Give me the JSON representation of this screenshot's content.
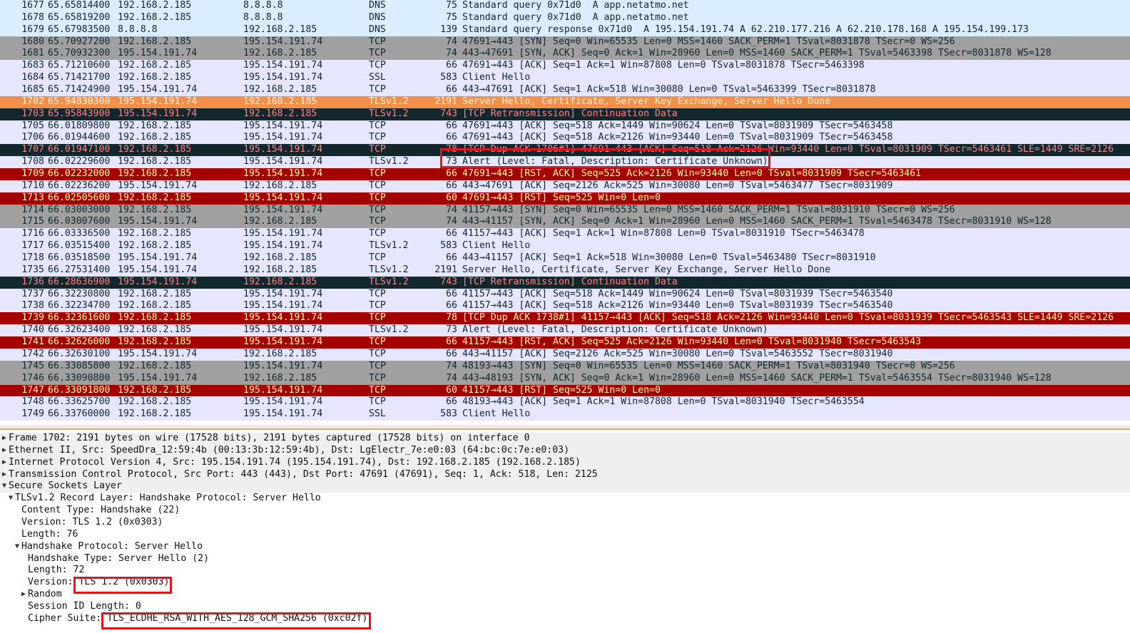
{
  "packet_list": {
    "rows": [
      {
        "no": "1677",
        "time": "65.65814400",
        "src": "192.168.2.185",
        "dst": "8.8.8.8",
        "proto": "DNS",
        "len": "75",
        "info": "Standard query 0x71d0  A app.netatmo.net",
        "style": "dns"
      },
      {
        "no": "1678",
        "time": "65.65819200",
        "src": "192.168.2.185",
        "dst": "8.8.8.8",
        "proto": "DNS",
        "len": "75",
        "info": "Standard query 0x71d0  A app.netatmo.net",
        "style": "dns"
      },
      {
        "no": "1679",
        "time": "65.67983500",
        "src": "8.8.8.8",
        "dst": "192.168.2.185",
        "proto": "DNS",
        "len": "139",
        "info": "Standard query response 0x71d0  A 195.154.191.74 A 62.210.177.216 A 62.210.178.168 A 195.154.199.173",
        "style": "dns"
      },
      {
        "no": "1680",
        "time": "65.70927200",
        "src": "192.168.2.185",
        "dst": "195.154.191.74",
        "proto": "TCP",
        "len": "74",
        "info": "47691→443 [SYN] Seq=0 Win=65535 Len=0 MSS=1460 SACK_PERM=1 TSval=8031878 TSecr=0 WS=256",
        "style": "gray"
      },
      {
        "no": "1681",
        "time": "65.70932300",
        "src": "195.154.191.74",
        "dst": "192.168.2.185",
        "proto": "TCP",
        "len": "74",
        "info": "443→47691 [SYN, ACK] Seq=0 Ack=1 Win=28960 Len=0 MSS=1460 SACK_PERM=1 TSval=5463398 TSecr=8031878 WS=128",
        "style": "gray"
      },
      {
        "no": "1683",
        "time": "65.71210600",
        "src": "192.168.2.185",
        "dst": "195.154.191.74",
        "proto": "TCP",
        "len": "66",
        "info": "47691→443 [ACK] Seq=1 Ack=1 Win=87808 Len=0 TSval=8031878 TSecr=5463398",
        "style": "tcp"
      },
      {
        "no": "1684",
        "time": "65.71421700",
        "src": "192.168.2.185",
        "dst": "195.154.191.74",
        "proto": "SSL",
        "len": "583",
        "info": "Client Hello",
        "style": "tcp"
      },
      {
        "no": "1685",
        "time": "65.71424900",
        "src": "195.154.191.74",
        "dst": "192.168.2.185",
        "proto": "TCP",
        "len": "66",
        "info": "443→47691 [ACK] Seq=1 Ack=518 Win=30080 Len=0 TSval=5463399 TSecr=8031878",
        "style": "tcp"
      },
      {
        "no": "1702",
        "time": "65.94830300",
        "src": "195.154.191.74",
        "dst": "192.168.2.185",
        "proto": "TLSv1.2",
        "len": "2191",
        "info": "Server Hello, Certificate, Server Key Exchange, Server Hello Done",
        "style": "orange"
      },
      {
        "no": "1703",
        "time": "65.95843900",
        "src": "195.154.191.74",
        "dst": "192.168.2.185",
        "proto": "TLSv1.2",
        "len": "743",
        "info": "[TCP Retransmission] Continuation Data",
        "style": "dark"
      },
      {
        "no": "1705",
        "time": "66.01809800",
        "src": "192.168.2.185",
        "dst": "195.154.191.74",
        "proto": "TCP",
        "len": "66",
        "info": "47691→443 [ACK] Seq=518 Ack=1449 Win=90624 Len=0 TSval=8031909 TSecr=5463458",
        "style": "tcp"
      },
      {
        "no": "1706",
        "time": "66.01944600",
        "src": "192.168.2.185",
        "dst": "195.154.191.74",
        "proto": "TCP",
        "len": "66",
        "info": "47691→443 [ACK] Seq=518 Ack=2126 Win=93440 Len=0 TSval=8031909 TSecr=5463458",
        "style": "tcp"
      },
      {
        "no": "1707",
        "time": "66.01947100",
        "src": "192.168.2.185",
        "dst": "195.154.191.74",
        "proto": "TCP",
        "len": "78",
        "info": "[TCP Dup ACK 1706#1] 47691→443 [ACK] Seq=518 Ack=2126 Win=93440 Len=0 TSval=8031909 TSecr=5463461 SLE=1449 SRE=2126",
        "style": "dark"
      },
      {
        "no": "1708",
        "time": "66.02229600",
        "src": "192.168.2.185",
        "dst": "195.154.191.74",
        "proto": "TLSv1.2",
        "len": "73",
        "info": "Alert (Level: Fatal, Description: Certificate Unknown)",
        "style": "tcp"
      },
      {
        "no": "1709",
        "time": "66.02232000",
        "src": "192.168.2.185",
        "dst": "195.154.191.74",
        "proto": "TCP",
        "len": "66",
        "info": "47691→443 [RST, ACK] Seq=525 Ack=2126 Win=93440 Len=0 TSval=8031909 TSecr=5463461",
        "style": "red"
      },
      {
        "no": "1710",
        "time": "66.02236200",
        "src": "195.154.191.74",
        "dst": "192.168.2.185",
        "proto": "TCP",
        "len": "66",
        "info": "443→47691 [ACK] Seq=2126 Ack=525 Win=30080 Len=0 TSval=5463477 TSecr=8031909",
        "style": "tcp"
      },
      {
        "no": "1713",
        "time": "66.02505600",
        "src": "192.168.2.185",
        "dst": "195.154.191.74",
        "proto": "TCP",
        "len": "60",
        "info": "47691→443 [RST] Seq=525 Win=0 Len=0",
        "style": "red"
      },
      {
        "no": "1714",
        "time": "66.03003000",
        "src": "192.168.2.185",
        "dst": "195.154.191.74",
        "proto": "TCP",
        "len": "74",
        "info": "41157→443 [SYN] Seq=0 Win=65535 Len=0 MSS=1460 SACK_PERM=1 TSval=8031910 TSecr=0 WS=256",
        "style": "gray"
      },
      {
        "no": "1715",
        "time": "66.03007600",
        "src": "195.154.191.74",
        "dst": "192.168.2.185",
        "proto": "TCP",
        "len": "74",
        "info": "443→41157 [SYN, ACK] Seq=0 Ack=1 Win=28960 Len=0 MSS=1460 SACK_PERM=1 TSval=5463478 TSecr=8031910 WS=128",
        "style": "gray"
      },
      {
        "no": "1716",
        "time": "66.03336500",
        "src": "192.168.2.185",
        "dst": "195.154.191.74",
        "proto": "TCP",
        "len": "66",
        "info": "41157→443 [ACK] Seq=1 Ack=1 Win=87808 Len=0 TSval=8031910 TSecr=5463478",
        "style": "tcp"
      },
      {
        "no": "1717",
        "time": "66.03515400",
        "src": "192.168.2.185",
        "dst": "195.154.191.74",
        "proto": "TLSv1.2",
        "len": "583",
        "info": "Client Hello",
        "style": "tcp"
      },
      {
        "no": "1718",
        "time": "66.03518500",
        "src": "195.154.191.74",
        "dst": "192.168.2.185",
        "proto": "TCP",
        "len": "66",
        "info": "443→41157 [ACK] Seq=1 Ack=518 Win=30080 Len=0 TSval=5463480 TSecr=8031910",
        "style": "tcp"
      },
      {
        "no": "1735",
        "time": "66.27531400",
        "src": "195.154.191.74",
        "dst": "192.168.2.185",
        "proto": "TLSv1.2",
        "len": "2191",
        "info": "Server Hello, Certificate, Server Key Exchange, Server Hello Done",
        "style": "tcp"
      },
      {
        "no": "1736",
        "time": "66.28636900",
        "src": "195.154.191.74",
        "dst": "192.168.2.185",
        "proto": "TLSv1.2",
        "len": "743",
        "info": "[TCP Retransmission] Continuation Data",
        "style": "dark"
      },
      {
        "no": "1737",
        "time": "66.32230800",
        "src": "192.168.2.185",
        "dst": "195.154.191.74",
        "proto": "TCP",
        "len": "66",
        "info": "41157→443 [ACK] Seq=518 Ack=1449 Win=90624 Len=0 TSval=8031939 TSecr=5463540",
        "style": "tcp"
      },
      {
        "no": "1738",
        "time": "66.32234700",
        "src": "192.168.2.185",
        "dst": "195.154.191.74",
        "proto": "TCP",
        "len": "66",
        "info": "41157→443 [ACK] Seq=518 Ack=2126 Win=93440 Len=0 TSval=8031939 TSecr=5463540",
        "style": "tcp"
      },
      {
        "no": "1739",
        "time": "66.32361600",
        "src": "192.168.2.185",
        "dst": "195.154.191.74",
        "proto": "TCP",
        "len": "78",
        "info": "[TCP Dup ACK 1738#1] 41157→443 [ACK] Seq=518 Ack=2126 Win=93440 Len=0 TSval=8031939 TSecr=5463543 SLE=1449 SRE=2126",
        "style": "red"
      },
      {
        "no": "1740",
        "time": "66.32623400",
        "src": "192.168.2.185",
        "dst": "195.154.191.74",
        "proto": "TLSv1.2",
        "len": "73",
        "info": "Alert (Level: Fatal, Description: Certificate Unknown)",
        "style": "tcp"
      },
      {
        "no": "1741",
        "time": "66.32626000",
        "src": "192.168.2.185",
        "dst": "195.154.191.74",
        "proto": "TCP",
        "len": "66",
        "info": "41157→443 [RST, ACK] Seq=525 Ack=2126 Win=93440 Len=0 TSval=8031940 TSecr=5463543",
        "style": "red"
      },
      {
        "no": "1742",
        "time": "66.32630100",
        "src": "195.154.191.74",
        "dst": "192.168.2.185",
        "proto": "TCP",
        "len": "66",
        "info": "443→41157 [ACK] Seq=2126 Ack=525 Win=30080 Len=0 TSval=5463552 TSecr=8031940",
        "style": "tcp"
      },
      {
        "no": "1745",
        "time": "66.33085800",
        "src": "192.168.2.185",
        "dst": "195.154.191.74",
        "proto": "TCP",
        "len": "74",
        "info": "48193→443 [SYN] Seq=0 Win=65535 Len=0 MSS=1460 SACK_PERM=1 TSval=8031940 TSecr=0 WS=256",
        "style": "gray"
      },
      {
        "no": "1746",
        "time": "66.33090800",
        "src": "195.154.191.74",
        "dst": "192.168.2.185",
        "proto": "TCP",
        "len": "74",
        "info": "443→48193 [SYN, ACK] Seq=0 Ack=1 Win=28960 Len=0 MSS=1460 SACK_PERM=1 TSval=5463554 TSecr=8031940 WS=128",
        "style": "gray"
      },
      {
        "no": "1747",
        "time": "66.33091800",
        "src": "192.168.2.185",
        "dst": "195.154.191.74",
        "proto": "TCP",
        "len": "60",
        "info": "41157→443 [RST] Seq=525 Win=0 Len=0",
        "style": "red"
      },
      {
        "no": "1748",
        "time": "66.33625700",
        "src": "192.168.2.185",
        "dst": "195.154.191.74",
        "proto": "TCP",
        "len": "66",
        "info": "48193→443 [ACK] Seq=1 Ack=1 Win=87808 Len=0 TSval=8031940 TSecr=5463554",
        "style": "tcp"
      },
      {
        "no": "1749",
        "time": "66.33760000",
        "src": "192.168.2.185",
        "dst": "195.154.191.74",
        "proto": "SSL",
        "len": "583",
        "info": "Client Hello",
        "style": "tcp"
      }
    ]
  },
  "details": {
    "lines": [
      {
        "indent": 0,
        "twisty": "closed",
        "text": "Frame 1702: 2191 bytes on wire (17528 bits), 2191 bytes captured (17528 bits) on interface 0",
        "shade": true
      },
      {
        "indent": 0,
        "twisty": "closed",
        "text": "Ethernet II, Src: SpeedDra_12:59:4b (00:13:3b:12:59:4b), Dst: LgElectr_7e:e0:03 (64:bc:0c:7e:e0:03)",
        "shade": true
      },
      {
        "indent": 0,
        "twisty": "closed",
        "text": "Internet Protocol Version 4, Src: 195.154.191.74 (195.154.191.74), Dst: 192.168.2.185 (192.168.2.185)",
        "shade": true
      },
      {
        "indent": 0,
        "twisty": "closed",
        "text": "Transmission Control Protocol, Src Port: 443 (443), Dst Port: 47691 (47691), Seq: 1, Ack: 518, Len: 2125",
        "shade": true
      },
      {
        "indent": 0,
        "twisty": "open",
        "text": "Secure Sockets Layer",
        "shade": true
      },
      {
        "indent": 1,
        "twisty": "open",
        "text": "TLSv1.2 Record Layer: Handshake Protocol: Server Hello",
        "shade": false
      },
      {
        "indent": 2,
        "twisty": "none",
        "text": "Content Type: Handshake (22)",
        "shade": false
      },
      {
        "indent": 2,
        "twisty": "none",
        "text": "Version: TLS 1.2 (0x0303)",
        "shade": false
      },
      {
        "indent": 2,
        "twisty": "none",
        "text": "Length: 76",
        "shade": false
      },
      {
        "indent": 2,
        "twisty": "open",
        "text": "Handshake Protocol: Server Hello",
        "shade": false
      },
      {
        "indent": 3,
        "twisty": "none",
        "text": "Handshake Type: Server Hello (2)",
        "shade": false
      },
      {
        "indent": 3,
        "twisty": "none",
        "text": "Length: 72",
        "shade": false
      },
      {
        "indent": 3,
        "twisty": "none",
        "text": "Version: TLS 1.2 (0x0303)",
        "shade": false
      },
      {
        "indent": 3,
        "twisty": "closed",
        "text": "Random",
        "shade": false
      },
      {
        "indent": 3,
        "twisty": "none",
        "text": "Session ID Length: 0",
        "shade": false
      },
      {
        "indent": 3,
        "twisty": "none",
        "text": "Cipher Suite: TLS_ECDHE_RSA_WITH_AES_128_GCM_SHA256 (0xc02f)",
        "shade": false
      }
    ]
  },
  "colors": {
    "dns": "#daeeff",
    "gray": "#a0a0a0",
    "tcp": "#e7e6ff",
    "orange": "#f0904b",
    "dark": "#12272e",
    "red": "#a40000",
    "highlight_box": "#e8121a"
  },
  "icons": {
    "expand": "triangle-right-icon",
    "collapse": "triangle-down-icon"
  }
}
